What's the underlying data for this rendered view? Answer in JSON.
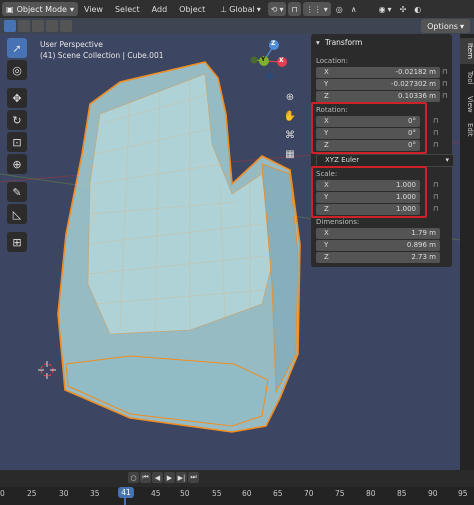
{
  "header": {
    "mode_label": "Object Mode",
    "menus": [
      "View",
      "Select",
      "Add",
      "Object"
    ],
    "orientation_label": "Global",
    "options_label": "Options"
  },
  "viewport": {
    "perspective_label": "User Perspective",
    "collection_label": "(41) Scene Collection | Cube.001",
    "gizmo_z": "Z",
    "gizmo_y": "Y",
    "gizmo_x": "X"
  },
  "npanel": {
    "title": "Transform",
    "location_label": "Location:",
    "location": [
      {
        "axis": "X",
        "value": "-0.02182 m"
      },
      {
        "axis": "Y",
        "value": "-0.027302 m"
      },
      {
        "axis": "Z",
        "value": "0.10336 m"
      }
    ],
    "rotation_label": "Rotation:",
    "rotation": [
      {
        "axis": "X",
        "value": "0°"
      },
      {
        "axis": "Y",
        "value": "0°"
      },
      {
        "axis": "Z",
        "value": "0°"
      }
    ],
    "rotation_mode": "XYZ Euler",
    "scale_label": "Scale:",
    "scale": [
      {
        "axis": "X",
        "value": "1.000"
      },
      {
        "axis": "Y",
        "value": "1.000"
      },
      {
        "axis": "Z",
        "value": "1.000"
      }
    ],
    "dimensions_label": "Dimensions:",
    "dimensions": [
      {
        "axis": "X",
        "value": "1.79 m"
      },
      {
        "axis": "Y",
        "value": "0.896 m"
      },
      {
        "axis": "Z",
        "value": "2.73 m"
      }
    ],
    "highlight_color": "#d0202a"
  },
  "tabs": [
    "Item",
    "Tool",
    "View",
    "Edit"
  ],
  "timeline": {
    "current_frame": "41",
    "frame_ticks": [
      "0",
      "25",
      "30",
      "35",
      "41",
      "45",
      "50",
      "55",
      "60",
      "65",
      "70",
      "75",
      "80",
      "85",
      "90",
      "95"
    ]
  },
  "colors": {
    "accent": "#4772b3",
    "viewport_bg": "#3c4561",
    "selection_outline": "#f08c20",
    "mesh_fill": "#a9d6d8"
  }
}
